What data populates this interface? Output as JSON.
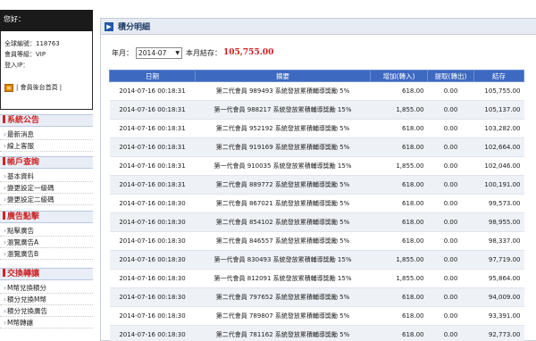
{
  "sidebar": {
    "greeting": "您好：",
    "user": {
      "id_line": "全球編號：118763",
      "level_line": "會員等級：VIP",
      "ip_line": "登入IP："
    },
    "backend_link": "| 會員後台首頁 |",
    "sections": [
      {
        "title": "系統公告",
        "items": [
          "最新消息",
          "線上客服"
        ]
      },
      {
        "title": "帳戶查詢",
        "items": [
          "基本資料",
          "變更設定一級碼",
          "變更設定二級碼"
        ]
      },
      {
        "title": "廣告點擊",
        "items": [
          "點擊廣告",
          "瀏覽廣告A",
          "瀏覽廣告B"
        ]
      },
      {
        "title": "交換轉讓",
        "items": [
          "M幣兌換積分",
          "積分兌換M幣",
          "積分兌換廣告",
          "M幣轉讓"
        ]
      }
    ]
  },
  "panel": {
    "title": "積分明細",
    "filter": {
      "year_label": "年月：",
      "month_value": "2014-07",
      "balance_label": "本月結存：",
      "balance_value": "105,755.00"
    }
  },
  "table": {
    "headers": [
      "日期",
      "摘要",
      "增加(轉入)",
      "提取(轉出)",
      "結存"
    ],
    "rows": [
      [
        "2014-07-16 00:18:31",
        "第二代會員 989493 系統發放累積輔導獎勵 5%",
        "618.00",
        "0.00",
        "105,755.00"
      ],
      [
        "2014-07-16 00:18:31",
        "第一代會員 988217 系統發放累積輔導獎勵 15%",
        "1,855.00",
        "0.00",
        "105,137.00"
      ],
      [
        "2014-07-16 00:18:31",
        "第二代會員 952192 系統發放累積輔導獎勵 5%",
        "618.00",
        "0.00",
        "103,282.00"
      ],
      [
        "2014-07-16 00:18:31",
        "第二代會員 919169 系統發放累積輔導獎勵 5%",
        "618.00",
        "0.00",
        "102,664.00"
      ],
      [
        "2014-07-16 00:18:31",
        "第一代會員 910035 系統發放累積輔導獎勵 15%",
        "1,855.00",
        "0.00",
        "102,046.00"
      ],
      [
        "2014-07-16 00:18:31",
        "第二代會員 889772 系統發放累積輔導獎勵 5%",
        "618.00",
        "0.00",
        "100,191.00"
      ],
      [
        "2014-07-16 00:18:30",
        "第二代會員 867021 系統發放累積輔導獎勵 5%",
        "618.00",
        "0.00",
        "99,573.00"
      ],
      [
        "2014-07-16 00:18:30",
        "第二代會員 854102 系統發放累積輔導獎勵 5%",
        "618.00",
        "0.00",
        "98,955.00"
      ],
      [
        "2014-07-16 00:18:30",
        "第二代會員 846557 系統發放累積輔導獎勵 5%",
        "618.00",
        "0.00",
        "98,337.00"
      ],
      [
        "2014-07-16 00:18:30",
        "第一代會員 830493 系統發放累積輔導獎勵 15%",
        "1,855.00",
        "0.00",
        "97,719.00"
      ],
      [
        "2014-07-16 00:18:30",
        "第一代會員 812091 系統發放累積輔導獎勵 15%",
        "1,855.00",
        "0.00",
        "95,864.00"
      ],
      [
        "2014-07-16 00:18:30",
        "第二代會員 797652 系統發放累積輔導獎勵 5%",
        "618.00",
        "0.00",
        "94,009.00"
      ],
      [
        "2014-07-16 00:18:30",
        "第二代會員 789807 系統發放累積輔導獎勵 5%",
        "618.00",
        "0.00",
        "93,391.00"
      ],
      [
        "2014-07-16 00:18:30",
        "第二代會員 781162 系統發放累積輔導獎勵 5%",
        "618.00",
        "0.00",
        "92,773.00"
      ]
    ]
  },
  "colors": {
    "header_blue": "#3d69c1",
    "balance_red": "#d21d1d",
    "section_red": "#c8282a"
  }
}
